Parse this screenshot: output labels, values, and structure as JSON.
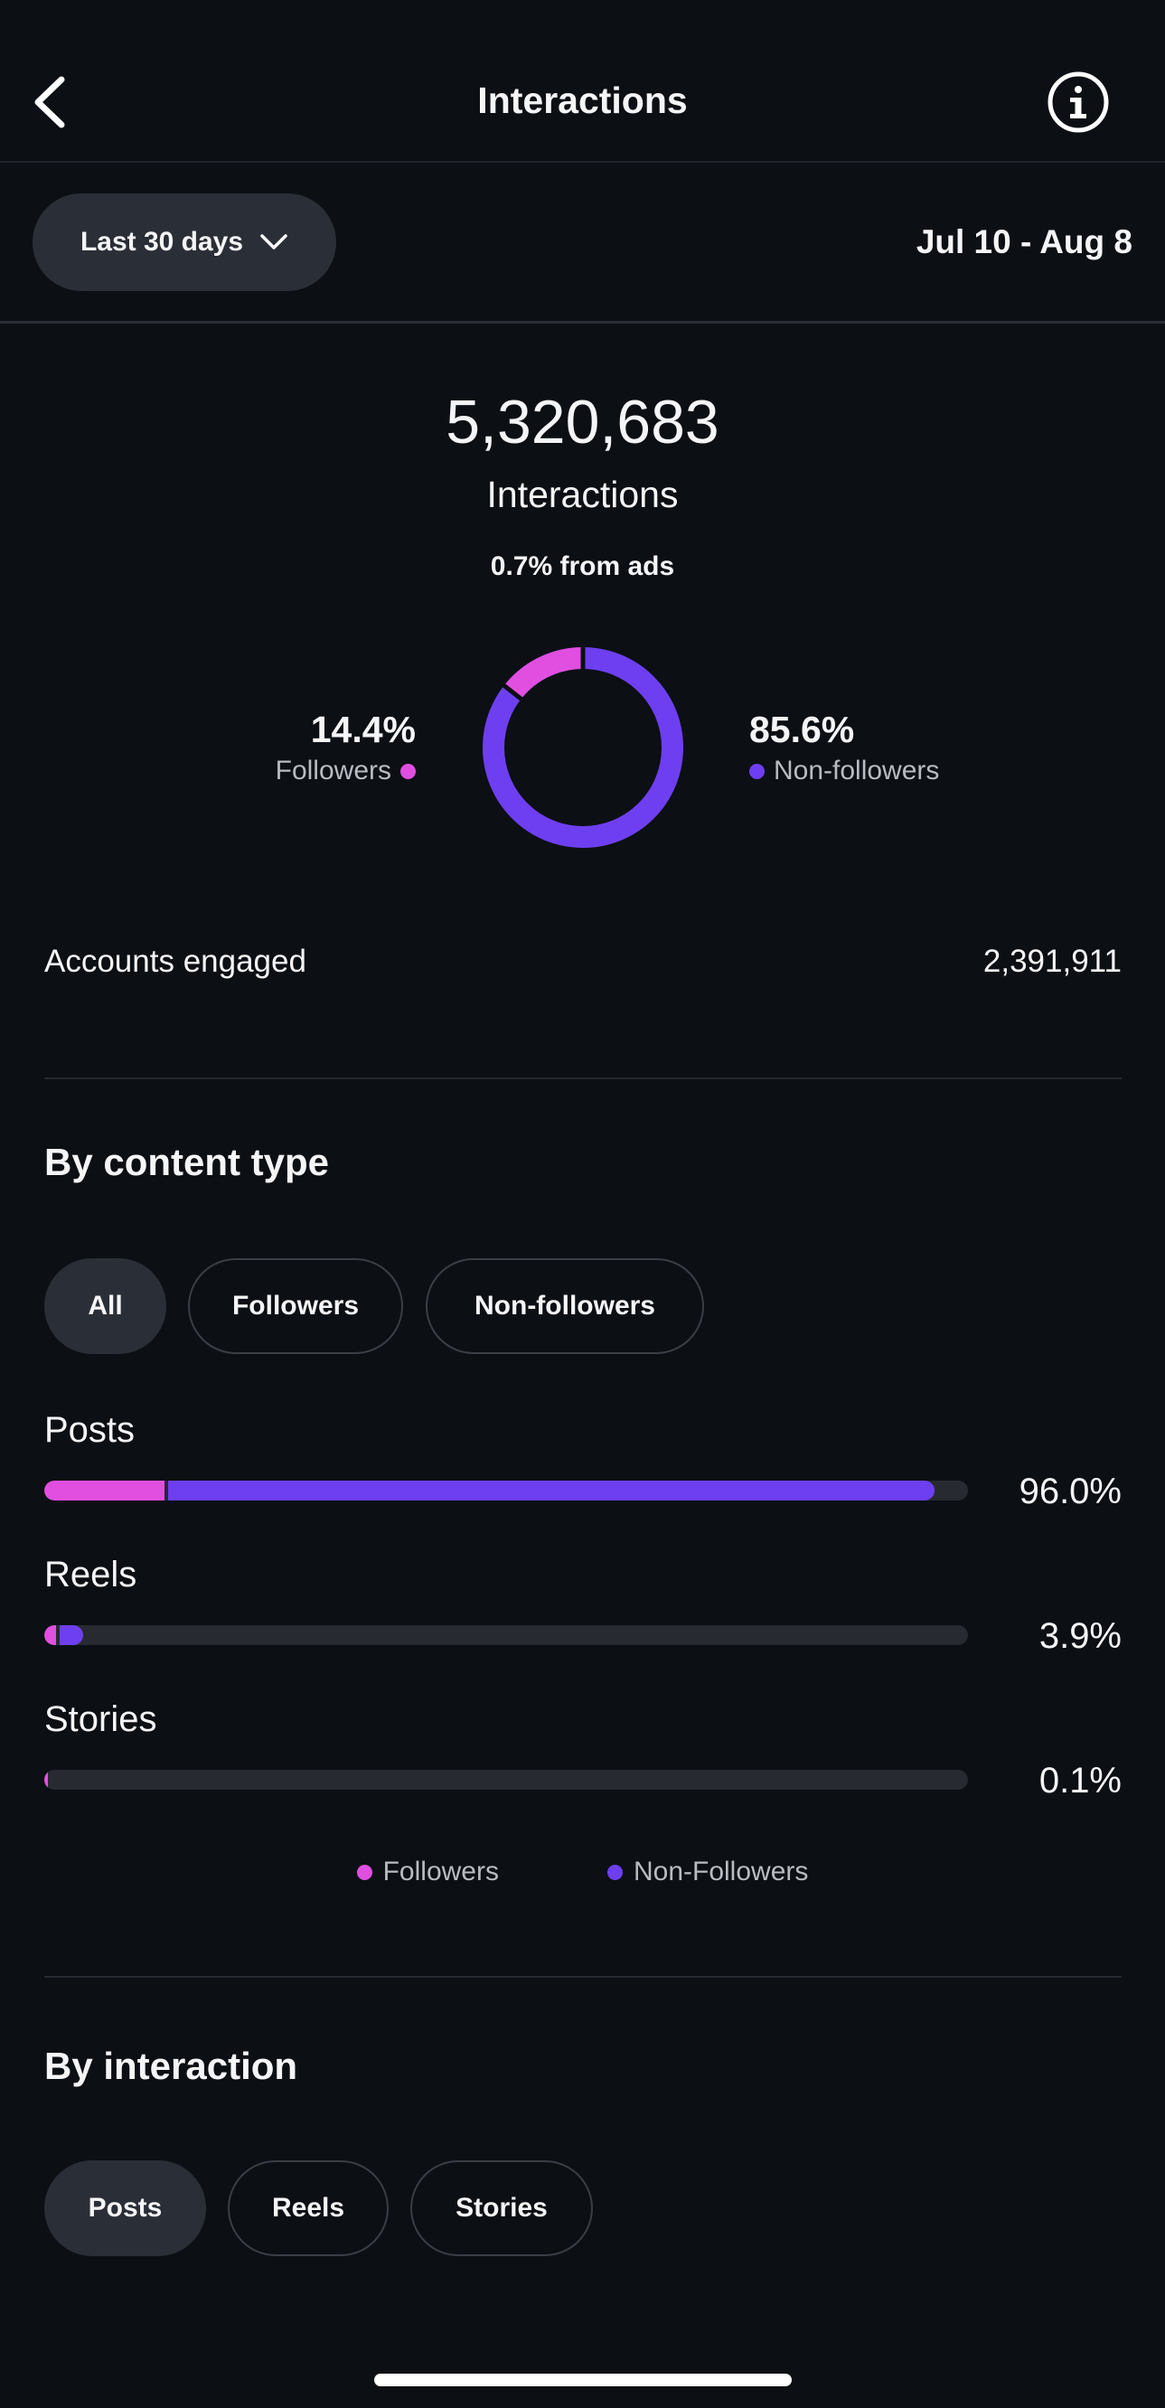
{
  "colors": {
    "followers": "#e04fe0",
    "non_followers": "#6e3ff0",
    "background": "#0c0f14"
  },
  "header": {
    "title": "Interactions",
    "back_icon": "chevron-left-icon",
    "info_icon": "info-icon"
  },
  "filter": {
    "range_label": "Last 30 days",
    "date_range": "Jul 10 - Aug 8"
  },
  "summary": {
    "total": "5,320,683",
    "total_label": "Interactions",
    "ads_note": "0.7% from ads",
    "followers_pct": "14.4%",
    "followers_label": "Followers",
    "non_followers_pct": "85.6%",
    "non_followers_label": "Non-followers",
    "followers_fraction": 0.144
  },
  "accounts": {
    "label": "Accounts engaged",
    "value": "2,391,911"
  },
  "content_type": {
    "title": "By content type",
    "filters": [
      "All",
      "Followers",
      "Non-followers"
    ],
    "active_filter": "All",
    "rows": [
      {
        "label": "Posts",
        "value": "96.0%",
        "followers_share": 0.13,
        "non_followers_share": 0.83
      },
      {
        "label": "Reels",
        "value": "3.9%",
        "followers_share": 0.013,
        "non_followers_share": 0.025
      },
      {
        "label": "Stories",
        "value": "0.1%",
        "followers_share": 0.002,
        "non_followers_share": 0.0
      }
    ],
    "legend": {
      "followers": "Followers",
      "non_followers": "Non-Followers"
    }
  },
  "by_interaction": {
    "title": "By interaction",
    "tabs": [
      "Posts",
      "Reels",
      "Stories"
    ],
    "active_tab": "Posts"
  }
}
